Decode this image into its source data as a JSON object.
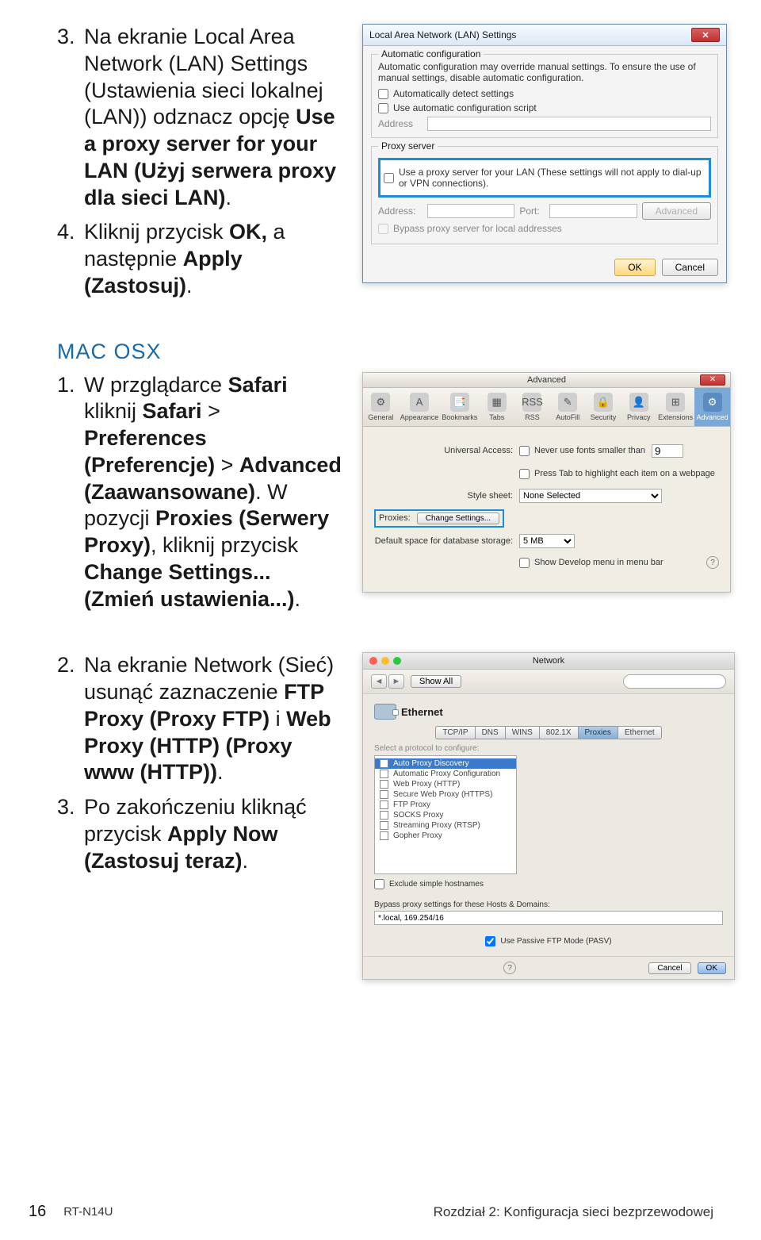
{
  "steps_a": [
    {
      "num": "3.",
      "text": "Na ekranie Local Area Network (LAN) Settings (Ustawienia sieci lokalnej (LAN)) odznacz opcję <b>Use a proxy server for your LAN (Użyj serwera proxy dla sieci LAN)</b>."
    },
    {
      "num": "4.",
      "text": "Kliknij przycisk <b>OK,</b> a następnie <b>Apply (Zastosuj)</b>."
    }
  ],
  "mac_heading": "MAC OSX",
  "steps_b": [
    {
      "num": "1.",
      "text": "W przglądarce <b>Safari</b> kliknij <b>Safari</b> > <b>Preferences (Preferencje)</b> > <b>Advanced (Zaawansowane)</b>. W pozycji <b>Proxies (Serwery Proxy)</b>, kliknij przycisk <b>Change Settings... (Zmień ustawienia...)</b>."
    }
  ],
  "steps_c": [
    {
      "num": "2.",
      "text": "Na ekranie Network (Sieć) usunąć zaznaczenie <b>FTP Proxy (Proxy FTP)</b> i <b>Web Proxy (HTTP) (Proxy www (HTTP))</b>."
    },
    {
      "num": "3.",
      "text": "Po zakończeniu kliknąć przycisk <b>Apply Now (Zastosuj teraz)</b>."
    }
  ],
  "lan": {
    "title": "Local Area Network (LAN) Settings",
    "grp_auto": "Automatic configuration",
    "auto_desc": "Automatic configuration may override manual settings. To ensure the use of manual settings, disable automatic configuration.",
    "auto_detect": "Automatically detect settings",
    "auto_script": "Use automatic configuration script",
    "addr_lbl": "Address",
    "grp_proxy": "Proxy server",
    "use_proxy": "Use a proxy server for your LAN (These settings will not apply to dial-up or VPN connections).",
    "address": "Address:",
    "port": "Port:",
    "advanced": "Advanced",
    "bypass": "Bypass proxy server for local addresses",
    "ok": "OK",
    "cancel": "Cancel"
  },
  "prefs": {
    "title": "Advanced",
    "tabs": [
      "General",
      "Appearance",
      "Bookmarks",
      "Tabs",
      "RSS",
      "AutoFill",
      "Security",
      "Privacy",
      "Extensions",
      "Advanced"
    ],
    "univ": "Universal Access:",
    "never_font": "Never use fonts smaller than",
    "font_val": "9",
    "tab_hl": "Press Tab to highlight each item on a webpage",
    "style": "Style sheet:",
    "style_val": "None Selected",
    "proxies": "Proxies:",
    "change": "Change Settings...",
    "storage": "Default space for database storage:",
    "storage_val": "5 MB",
    "devmenu": "Show Develop menu in menu bar"
  },
  "net": {
    "title": "Network",
    "nav_back": "◄",
    "nav_fwd": "►",
    "show_all": "Show All",
    "ethernet": "Ethernet",
    "tabs": [
      "TCP/IP",
      "DNS",
      "WINS",
      "802.1X",
      "Proxies",
      "Ethernet"
    ],
    "select_protocol": "Select a protocol to configure:",
    "protocols": [
      "Auto Proxy Discovery",
      "Automatic Proxy Configuration",
      "Web Proxy (HTTP)",
      "Secure Web Proxy (HTTPS)",
      "FTP Proxy",
      "SOCKS Proxy",
      "Streaming Proxy (RTSP)",
      "Gopher Proxy"
    ],
    "excl_hosts": "Exclude simple hostnames",
    "bypass_lbl": "Bypass proxy settings for these Hosts & Domains:",
    "bypass_val": "*.local, 169.254/16",
    "pasv": "Use Passive FTP Mode (PASV)",
    "cancel": "Cancel",
    "ok": "OK"
  },
  "footer": {
    "page": "16",
    "model": "RT-N14U",
    "chapter": "Rozdział 2: Konfiguracja sieci bezprzewodowej"
  }
}
